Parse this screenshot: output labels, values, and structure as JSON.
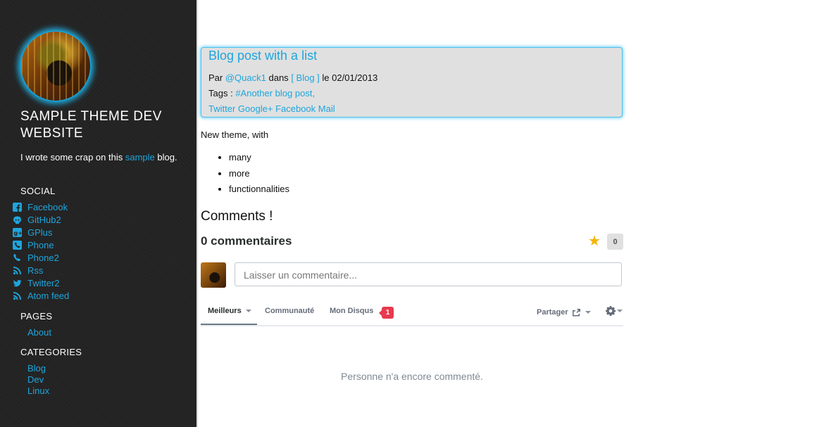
{
  "site": {
    "title": "SAMPLE THEME DEV WEBSITE",
    "description_text": "I wrote some crap on this ",
    "description_link": "sample",
    "description_end": " blog."
  },
  "social": {
    "heading": "SOCIAL",
    "items": [
      {
        "label": "Facebook",
        "icon": "facebook-icon"
      },
      {
        "label": "GitHub2",
        "icon": "github-icon"
      },
      {
        "label": "GPlus",
        "icon": "google-plus-icon"
      },
      {
        "label": "Phone",
        "icon": "phone-square-icon"
      },
      {
        "label": "Phone2",
        "icon": "phone-icon"
      },
      {
        "label": "Rss",
        "icon": "rss-icon"
      },
      {
        "label": "Twitter2",
        "icon": "twitter-icon"
      },
      {
        "label": "Atom feed",
        "icon": "rss-icon"
      }
    ]
  },
  "pages": {
    "heading": "PAGES",
    "items": [
      "About"
    ]
  },
  "categories": {
    "heading": "CATEGORIES",
    "items": [
      "Blog",
      "Dev",
      "Linux"
    ]
  },
  "post": {
    "title": "Blog post with a list",
    "by_label": "Par",
    "author": "@Quack1",
    "in_label": "dans",
    "category": "[ Blog ]",
    "date_label": "le 02/01/2013",
    "tags_label": "Tags :",
    "tag": "#Another blog post,",
    "share_links": [
      "Twitter",
      "Google+",
      "Facebook",
      "Mail"
    ],
    "intro": "New theme, with",
    "list": [
      "many",
      "more",
      "functionnalities"
    ]
  },
  "comments": {
    "heading": "Comments !",
    "count_label": "0 commentaires",
    "recommend_count": "0",
    "input_placeholder": "Laisser un commentaire...",
    "tabs": {
      "best": "Meilleurs",
      "community": "Communauté",
      "my_disqus": "Mon Disqus",
      "my_disqus_badge": "1"
    },
    "share_label": "Partager",
    "empty_message": "Personne n'a encore commenté."
  },
  "colors": {
    "link": "#1ea5dc",
    "sidebar_bg": "#222222",
    "badge": "#e73a4e",
    "star": "#f4b400"
  }
}
